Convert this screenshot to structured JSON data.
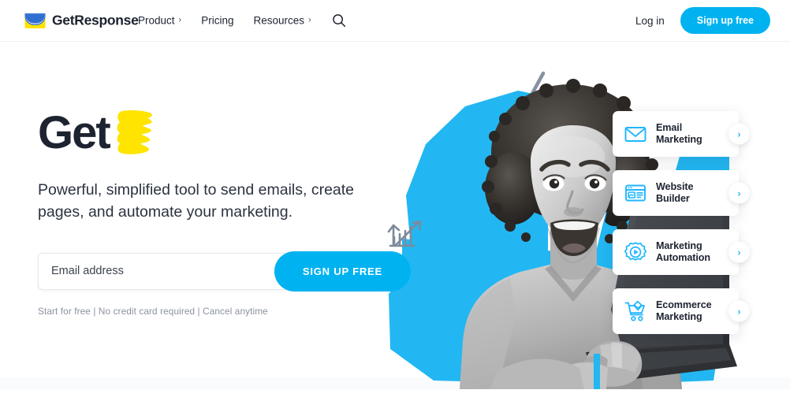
{
  "header": {
    "logo": {
      "text": "GetResponse",
      "icon": "envelope-logo-icon"
    },
    "nav": [
      {
        "label": "Product",
        "chevron": "›",
        "has_chevron": true
      },
      {
        "label": "Pricing",
        "chevron": "",
        "has_chevron": false
      },
      {
        "label": "Resources",
        "chevron": "›",
        "has_chevron": true
      }
    ],
    "search_icon": "search-icon",
    "login_label": "Log in",
    "signup_label": "Sign up free"
  },
  "hero": {
    "headline_text": "Get",
    "headline_marker": "yellow-marker-scribble",
    "subheadline": "Powerful, simplified tool to send emails, create pages, and automate your marketing.",
    "email_placeholder": "Email address",
    "email_value": "",
    "cta_label": "SIGN UP FREE",
    "fineprint": "Start for free | No credit card required | Cancel anytime"
  },
  "cards": [
    {
      "label": "Email\nMarketing",
      "icon": "envelope-icon",
      "arrow": "›"
    },
    {
      "label": "Website\nBuilder",
      "icon": "browser-window-icon",
      "arrow": "›"
    },
    {
      "label": "Marketing\nAutomation",
      "icon": "gear-play-icon",
      "arrow": "›"
    },
    {
      "label": "Ecommerce\nMarketing",
      "icon": "shopping-cart-icon",
      "arrow": "›"
    }
  ],
  "artwork": {
    "description": "grayscale-photo-woman-with-laptop-on-cyan-polygon",
    "doodles": [
      "bar-chart-arrow-doodle",
      "motion-lines-doodle"
    ]
  },
  "colors": {
    "brand_blue": "#00b3f0",
    "accent_cyan": "#1fb6ff",
    "logo_yellow": "#ffe200",
    "marker_yellow": "#ffe400",
    "text_dark": "#1d2330",
    "text_muted": "#8b929d",
    "doodle_gray": "#7d8a9c"
  }
}
